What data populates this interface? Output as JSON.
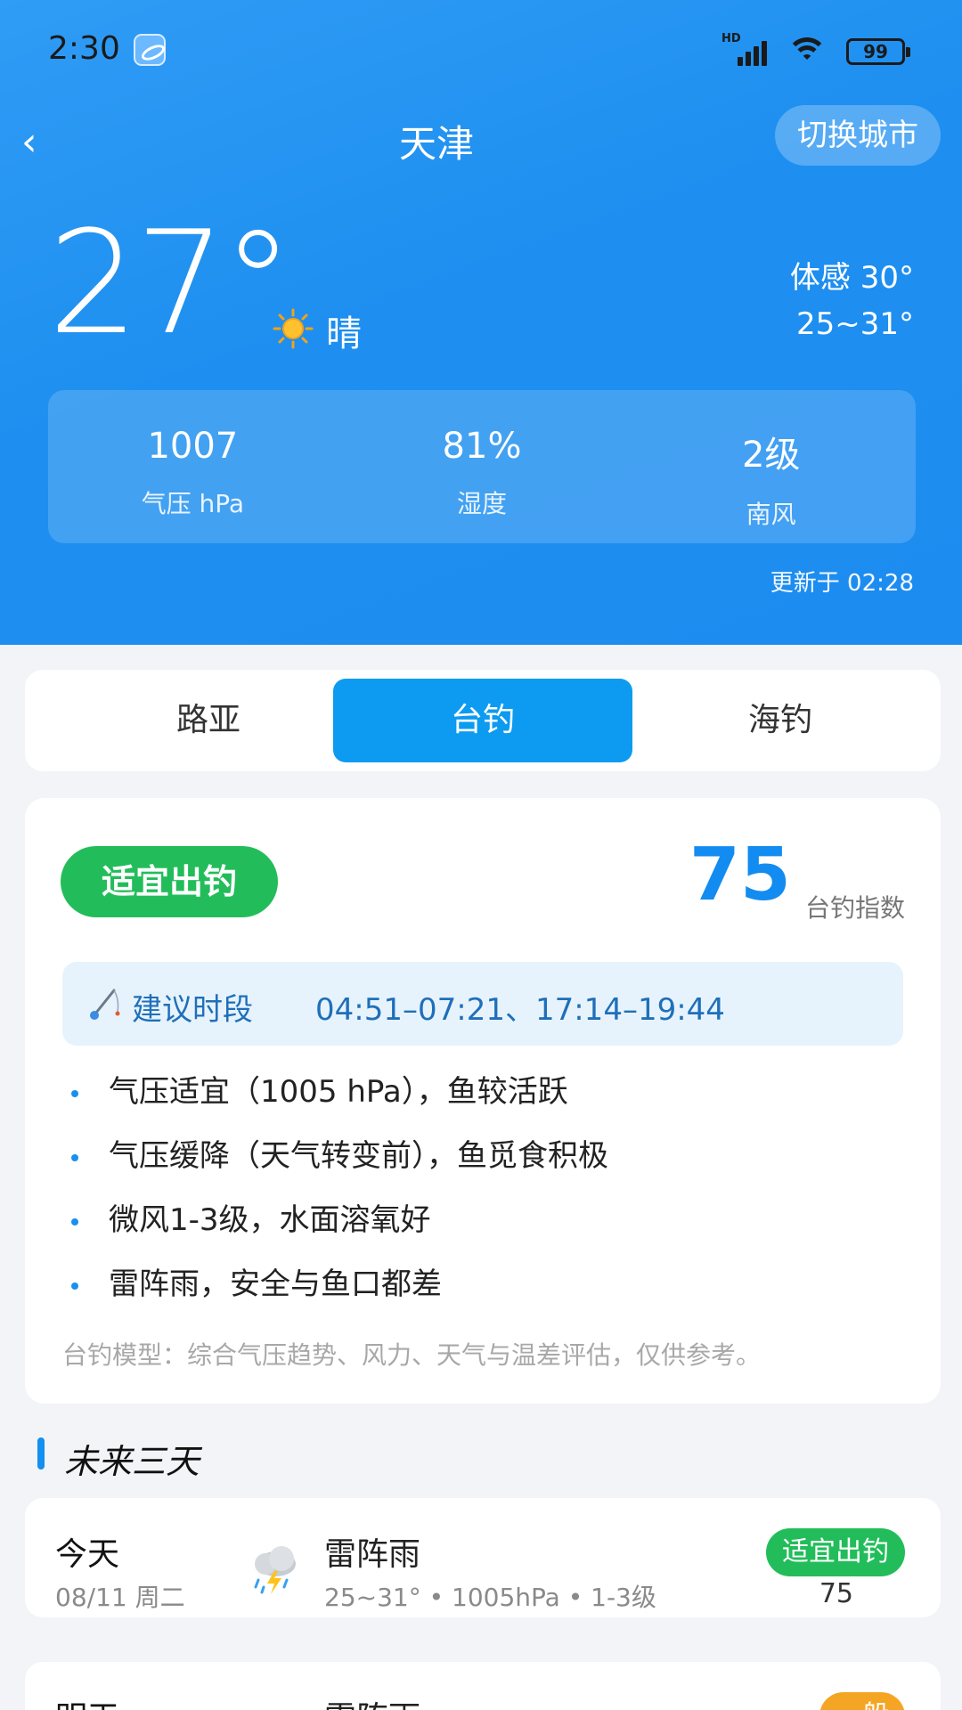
{
  "status_bar": {
    "time": "2:30",
    "signal_label": "HD",
    "battery": "99"
  },
  "header": {
    "city": "天津",
    "back_glyph": "‹",
    "switch_city_label": "切换城市",
    "temperature": "27°",
    "condition": "晴",
    "feels_like": "体感 30°",
    "temp_range": "25~31°",
    "updated": "更新于 02:28"
  },
  "stats": [
    {
      "value": "1007",
      "label": "气压 hPa"
    },
    {
      "value": "81%",
      "label": "湿度"
    },
    {
      "value": "2级",
      "label": "南风"
    }
  ],
  "tabs": [
    {
      "label": "路亚",
      "active": false
    },
    {
      "label": "台钓",
      "active": true
    },
    {
      "label": "海钓",
      "active": false
    }
  ],
  "fishing": {
    "suitability": "适宜出钓",
    "index_value": "75",
    "index_label": "台钓指数",
    "period_label": "建议时段",
    "period_times": "04:51–07:21、17:14–19:44",
    "tips": [
      "气压适宜（1005 hPa），鱼较活跃",
      "气压缓降（天气转变前），鱼觅食积极",
      "微风1-3级，水面溶氧好",
      "雷阵雨，安全与鱼口都差"
    ],
    "note": "台钓模型：综合气压趋势、风力、天气与温差评估，仅供参考。"
  },
  "forecast": {
    "title": "未来三天",
    "days": [
      {
        "name": "今天",
        "date": "08/11 周二",
        "icon": "thunderstorm-icon",
        "weather": "雷阵雨",
        "details": "25~31° • 1005hPa • 1-3级",
        "badge": "适宜出钓",
        "badge_color": "#22bd5a",
        "score": "75"
      },
      {
        "name": "明天",
        "date": "",
        "icon": "thunderstorm-icon",
        "weather": "雷阵雨",
        "details": "",
        "badge": "一般",
        "badge_color": "#f5a524",
        "score": ""
      }
    ]
  },
  "colors": {
    "header_blue": "#1e8ff0",
    "tab_active": "#0c9bf0",
    "suitable_green": "#22bd5a",
    "index_blue": "#128cf0",
    "average_orange": "#f5a524"
  }
}
